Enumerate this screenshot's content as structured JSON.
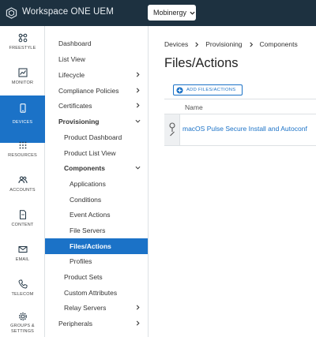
{
  "topbar": {
    "app_title": "Workspace ONE UEM",
    "org_selector": "Mobinergy"
  },
  "rail": {
    "items": [
      {
        "label": "FREESTYLE",
        "icon": "freestyle-icon"
      },
      {
        "label": "MONITOR",
        "icon": "monitor-icon"
      },
      {
        "label": "DEVICES",
        "icon": "devices-icon",
        "active": true
      },
      {
        "label": "RESOURCES",
        "icon": "resources-icon"
      },
      {
        "label": "ACCOUNTS",
        "icon": "accounts-icon"
      },
      {
        "label": "CONTENT",
        "icon": "content-icon"
      },
      {
        "label": "EMAIL",
        "icon": "email-icon"
      },
      {
        "label": "TELECOM",
        "icon": "telecom-icon"
      },
      {
        "label": "GROUPS &",
        "label2": "SETTINGS",
        "icon": "settings-icon"
      }
    ]
  },
  "tree": {
    "items": [
      {
        "label": "Dashboard"
      },
      {
        "label": "List View"
      },
      {
        "label": "Lifecycle"
      },
      {
        "label": "Compliance Policies"
      },
      {
        "label": "Certificates"
      },
      {
        "label": "Provisioning"
      },
      {
        "label": "Product Dashboard"
      },
      {
        "label": "Product List View"
      },
      {
        "label": "Components"
      },
      {
        "label": "Applications"
      },
      {
        "label": "Conditions"
      },
      {
        "label": "Event Actions"
      },
      {
        "label": "File Servers"
      },
      {
        "label": "Files/Actions"
      },
      {
        "label": "Profiles"
      },
      {
        "label": "Product Sets"
      },
      {
        "label": "Custom Attributes"
      },
      {
        "label": "Relay Servers"
      },
      {
        "label": "Peripherals"
      }
    ]
  },
  "main": {
    "breadcrumb": [
      "Devices",
      "Provisioning",
      "Components"
    ],
    "title": "Files/Actions",
    "add_button": "ADD FILES/ACTIONS",
    "table": {
      "columns": [
        "Name"
      ],
      "rows": [
        {
          "name": "macOS Pulse Secure Install and Autoconf"
        }
      ]
    }
  },
  "colors": {
    "topbar": "#1d3140",
    "accent": "#1b72c7",
    "link": "#1b72c7"
  }
}
